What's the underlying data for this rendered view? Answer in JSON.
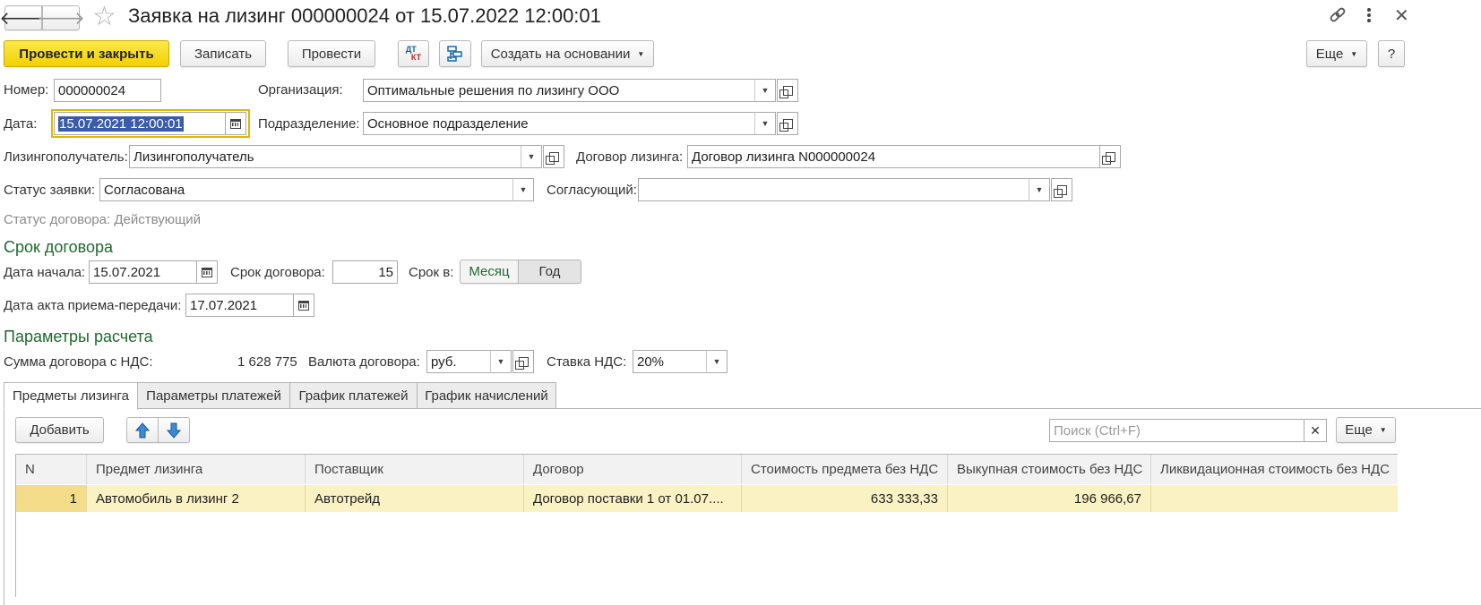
{
  "window": {
    "title": "Заявка на лизинг 000000024 от 15.07.2022 12:00:01"
  },
  "toolbar": {
    "post_close": "Провести и закрыть",
    "save": "Записать",
    "post": "Провести",
    "dtkt_top": "ДТ",
    "dtkt_bottom": "КТ",
    "create_based": "Создать на основании",
    "more": "Еще",
    "help": "?"
  },
  "form": {
    "number_label": "Номер:",
    "number_value": "000000024",
    "org_label": "Организация:",
    "org_value": "Оптимальные решения по лизингу ООО",
    "date_label": "Дата:",
    "date_value": "15.07.2021 12:00:01",
    "division_label": "Подразделение:",
    "division_value": "Основное подразделение",
    "lessee_label": "Лизингополучатель:",
    "lessee_value": "Лизингополучатель",
    "contract_label": "Договор лизинга:",
    "contract_value": "Договор лизинга N000000024",
    "status_label": "Статус заявки:",
    "status_value": "Согласована",
    "approver_label": "Согласующий:",
    "approver_value": "",
    "contract_status": "Статус договора: Действующий"
  },
  "term": {
    "section": "Срок договора",
    "start_label": "Дата начала:",
    "start_value": "15.07.2021",
    "term_label": "Срок договора:",
    "term_value": "15",
    "unit_label": "Срок в:",
    "unit_month": "Месяц",
    "unit_year": "Год",
    "act_label": "Дата акта приема-передачи:",
    "act_value": "17.07.2021"
  },
  "calc": {
    "section": "Параметры расчета",
    "sum_label": "Сумма договора с НДС:",
    "sum_value": "1 628 775",
    "currency_label": "Валюта договора:",
    "currency_value": "руб.",
    "vat_label": "Ставка НДС:",
    "vat_value": "20%"
  },
  "tabs": [
    "Предметы лизинга",
    "Параметры платежей",
    "График платежей",
    "График начислений"
  ],
  "table_toolbar": {
    "add": "Добавить",
    "search_placeholder": "Поиск (Ctrl+F)",
    "more": "Еще"
  },
  "table": {
    "columns": [
      "N",
      "Предмет лизинга",
      "Поставщик",
      "Договор",
      "Стоимость предмета без НДС",
      "Выкупная стоимость без НДС",
      "Ликвидационная стоимость без НДС"
    ],
    "rows": [
      [
        "1",
        "Автомобиль в лизинг 2",
        "Автотрейд",
        "Договор поставки 1 от 01.07....",
        "633 333,33",
        "196 966,67",
        ""
      ]
    ]
  },
  "colors": {
    "primary_button": "#f3d100",
    "section_title": "#1e6b2c",
    "selected_row": "#fbf2c4",
    "focus_border": "#e0b800"
  }
}
